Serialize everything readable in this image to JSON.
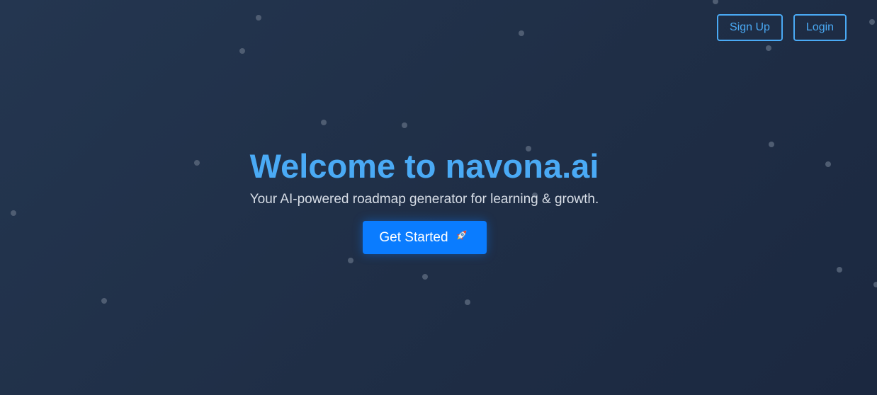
{
  "nav": {
    "signup_label": "Sign Up",
    "login_label": "Login"
  },
  "hero": {
    "title": "Welcome to navona.ai",
    "subtitle": "Your AI-powered roadmap generator for learning & growth.",
    "cta_label": "Get Started",
    "cta_icon": "rocket-icon"
  },
  "colors": {
    "accent": "#4aaaf5",
    "button": "#0a7cff",
    "background": "#22324b",
    "particle": "#4f5d72"
  }
}
